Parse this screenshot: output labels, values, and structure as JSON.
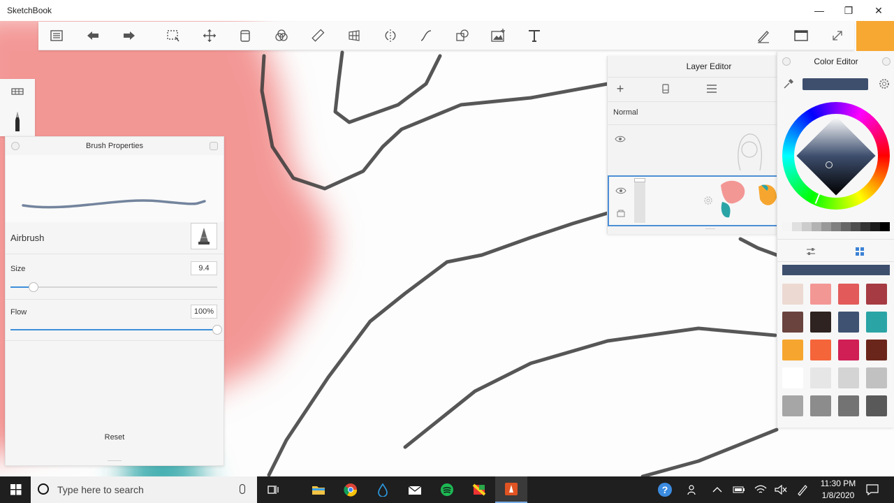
{
  "window": {
    "title": "SketchBook",
    "minimize_glyph": "—",
    "restore_glyph": "❐",
    "close_glyph": "✕"
  },
  "toolbar": {
    "icons": [
      "lagoon-menu-icon",
      "undo-icon",
      "redo-icon",
      "select-icon",
      "move-icon",
      "bucket-icon",
      "symmetry-circles-icon",
      "ruler-icon",
      "perspective-icon",
      "mirror-icon",
      "curve-icon",
      "shapes-icon",
      "image-insert-icon",
      "text-icon",
      "pen-tool-icon",
      "window-icon",
      "fullscreen-icon"
    ]
  },
  "brush_properties": {
    "title": "Brush Properties",
    "brush_name": "Airbrush",
    "size_label": "Size",
    "size_value": "9.4",
    "size_fraction": 0.11,
    "flow_label": "Flow",
    "flow_value": "100%",
    "flow_fraction": 1.0,
    "reset_label": "Reset"
  },
  "layer_editor": {
    "title": "Layer Editor",
    "blend_mode": "Normal",
    "icons": [
      "add-layer-icon",
      "layer-delete-icon",
      "layer-menu-icon"
    ]
  },
  "color_editor": {
    "title": "Color Editor",
    "current_color": "#3e4f6e",
    "gray_ramp": [
      "#f5f5f5",
      "#e0e0e0",
      "#cccccc",
      "#b3b3b3",
      "#999999",
      "#808080",
      "#666666",
      "#4d4d4d",
      "#333333",
      "#1a1a1a",
      "#000000"
    ],
    "swatches": [
      "#ecd9d1",
      "#f39795",
      "#e25a5a",
      "#a63b43",
      "#6a433e",
      "#2e2320",
      "#3f5272",
      "#2ba4a6",
      "#f6a62f",
      "#f5653a",
      "#cf1f55",
      "#6b261b",
      "#ffffff",
      "#e6e6e6",
      "#d4d4d4",
      "#c1c1c1",
      "#a6a6a6",
      "#8c8c8c",
      "#737373",
      "#595959"
    ]
  },
  "taskbar": {
    "search_placeholder": "Type here to search",
    "time": "11:30 PM",
    "date": "1/8/2020"
  }
}
